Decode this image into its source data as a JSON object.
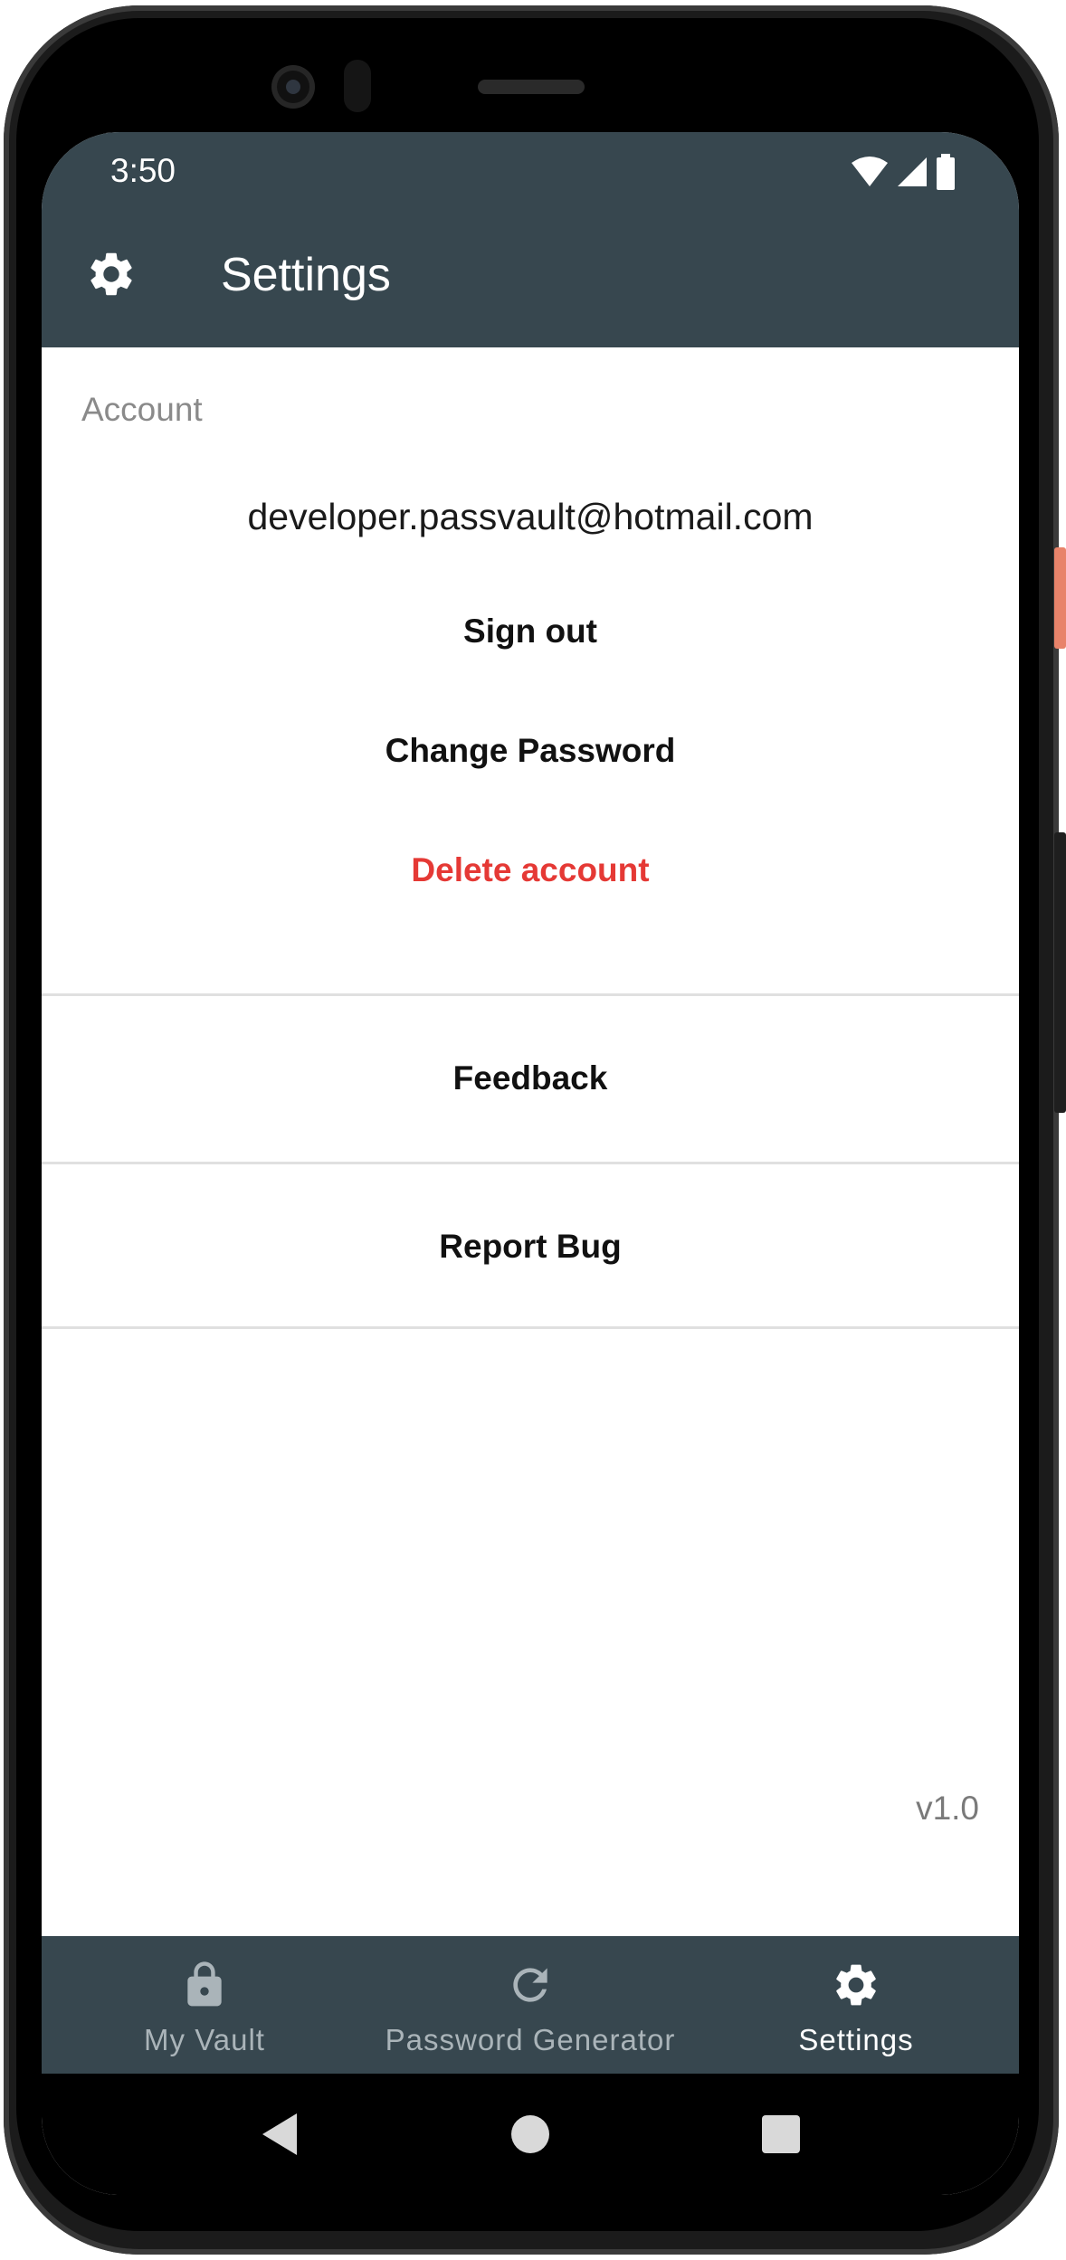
{
  "status_bar": {
    "time": "3:50",
    "icons": [
      "wifi-icon",
      "cellular-signal-icon",
      "battery-icon"
    ]
  },
  "app_bar": {
    "title": "Settings",
    "icon": "gear-icon"
  },
  "account": {
    "section_label": "Account",
    "email": "developer.passvault@hotmail.com",
    "sign_out": "Sign out",
    "change_password": "Change Password",
    "delete_account": "Delete account"
  },
  "rows": {
    "feedback": "Feedback",
    "report_bug": "Report Bug"
  },
  "version": "v1.0",
  "bottom_nav": {
    "items": [
      {
        "label": "My Vault",
        "icon": "lock-icon",
        "active": false
      },
      {
        "label": "Password Generator",
        "icon": "refresh-icon",
        "active": false
      },
      {
        "label": "Settings",
        "icon": "gear-icon",
        "active": true
      }
    ]
  },
  "system_nav": [
    "back-icon",
    "home-icon",
    "recents-icon"
  ],
  "colors": {
    "app_bar": "#37474f",
    "danger": "#e53935",
    "nav_inactive": "#aab4b9",
    "nav_active": "#ffffff"
  }
}
